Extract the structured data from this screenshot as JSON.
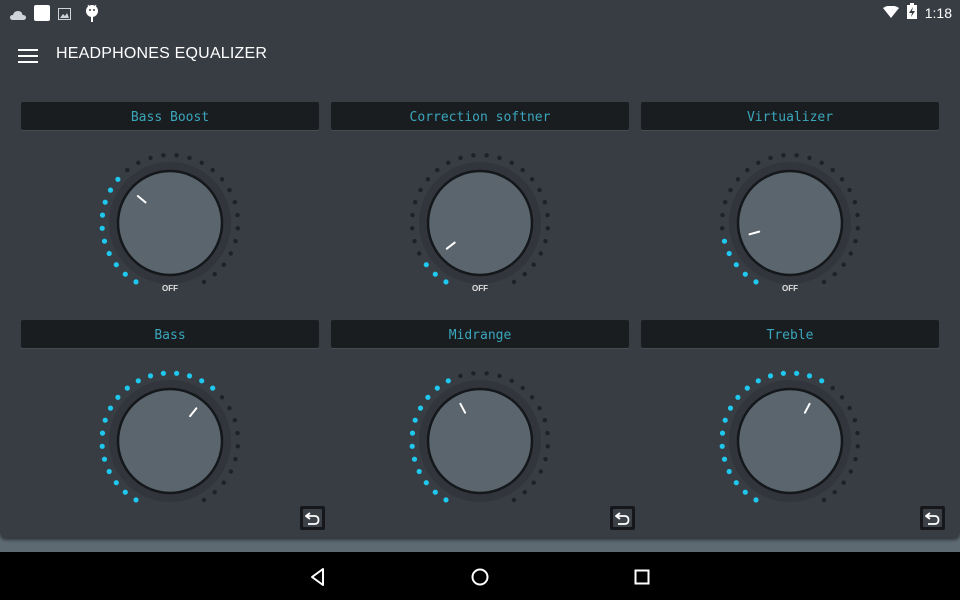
{
  "status_bar": {
    "left_icons": [
      "cloud-icon",
      "white-square-icon",
      "image-icon",
      "android-icon"
    ],
    "right_icons": [
      "wifi-icon",
      "battery-charging-icon"
    ],
    "time": "1:18"
  },
  "toolbar": {
    "menu_icon": "hamburger-menu-icon",
    "title": "HEADPHONES EQUALIZER"
  },
  "colors": {
    "accent": "#1ec8ee",
    "dot_inactive": "#1e2226",
    "label_text": "#3aa6bc",
    "background": "#383d44",
    "knob_face": "#5a656e"
  },
  "knob_dot_count": 28,
  "effects": [
    {
      "id": "bass-boost",
      "label": "Bass Boost",
      "lit_dots": 10,
      "sub_label": "OFF",
      "reset": false
    },
    {
      "id": "correction-softner",
      "label": "Correction softner",
      "lit_dots": 3,
      "sub_label": "OFF",
      "reset": false
    },
    {
      "id": "virtualizer",
      "label": "Virtualizer",
      "lit_dots": 5,
      "sub_label": "OFF",
      "reset": false
    }
  ],
  "bands": [
    {
      "id": "bass",
      "label": "Bass",
      "lit_dots": 18,
      "reset": true
    },
    {
      "id": "midrange",
      "label": "Midrange",
      "lit_dots": 12,
      "reset": true
    },
    {
      "id": "treble",
      "label": "Treble",
      "lit_dots": 17,
      "reset": true
    }
  ],
  "reset_icon": "undo-arrow-icon",
  "nav_bar": [
    "back-icon",
    "home-icon",
    "recents-icon"
  ]
}
